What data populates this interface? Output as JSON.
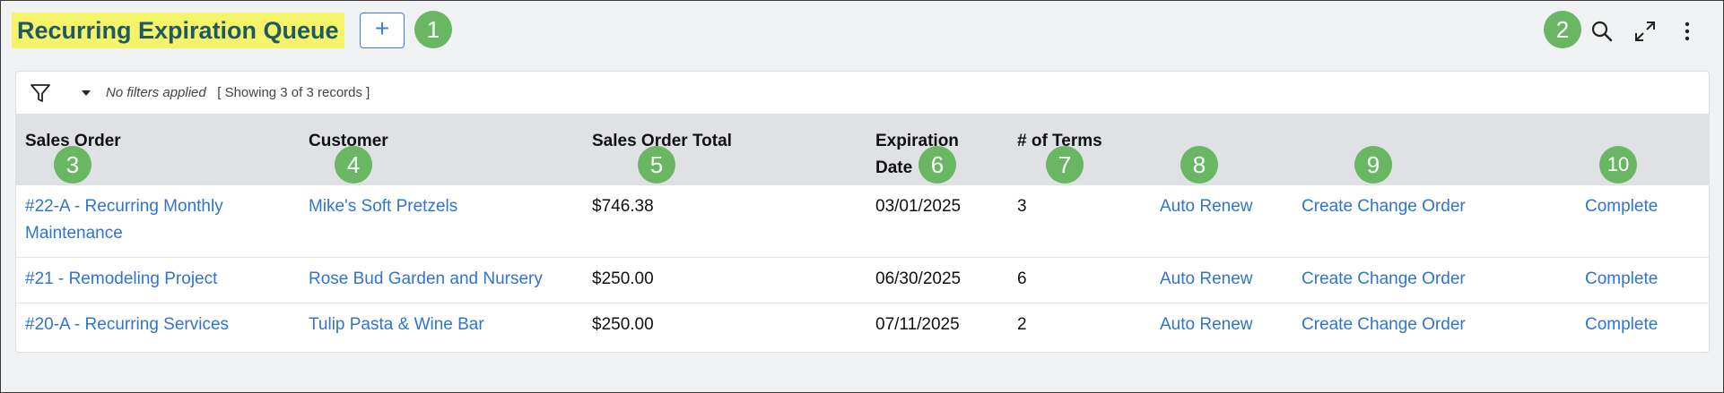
{
  "header": {
    "title": "Recurring Expiration Queue",
    "add_label": "+"
  },
  "markers": [
    "1",
    "2",
    "3",
    "4",
    "5",
    "6",
    "7",
    "8",
    "9",
    "10"
  ],
  "filter": {
    "status": "No filters applied",
    "count": "[ Showing 3 of 3 records ]"
  },
  "columns": {
    "sales_order": "Sales Order",
    "customer": "Customer",
    "total": "Sales Order Total",
    "expiration_line1": "Expiration",
    "expiration_line2": "Date",
    "terms": "# of Terms"
  },
  "rows": [
    {
      "sales_order_line1": "#22-A - Recurring Monthly",
      "sales_order_line2": "Maintenance",
      "customer": "Mike's Soft Pretzels",
      "total": "$746.38",
      "expiration": "03/01/2025",
      "terms": "3",
      "auto_renew": "Auto Renew",
      "change_order": "Create Change Order",
      "complete": "Complete"
    },
    {
      "sales_order": "#21 - Remodeling Project",
      "customer": "Rose Bud Garden and Nursery",
      "total": "$250.00",
      "expiration": "06/30/2025",
      "terms": "6",
      "auto_renew": "Auto Renew",
      "change_order": "Create Change Order",
      "complete": "Complete"
    },
    {
      "sales_order": "#20-A - Recurring Services",
      "customer": "Tulip Pasta & Wine Bar",
      "total": "$250.00",
      "expiration": "07/11/2025",
      "terms": "2",
      "auto_renew": "Auto Renew",
      "change_order": "Create Change Order",
      "complete": "Complete"
    }
  ],
  "icons": {
    "search": "search-icon",
    "expand": "expand-icon",
    "more": "more-vertical-icon",
    "filter": "filter-icon",
    "caret": "caret-down-icon"
  },
  "colors": {
    "title_highlight": "#f5f36a",
    "title_text": "#1d5a63",
    "link": "#2f74d0",
    "marker": "#69b663",
    "header_row": "#dfe1e5"
  }
}
